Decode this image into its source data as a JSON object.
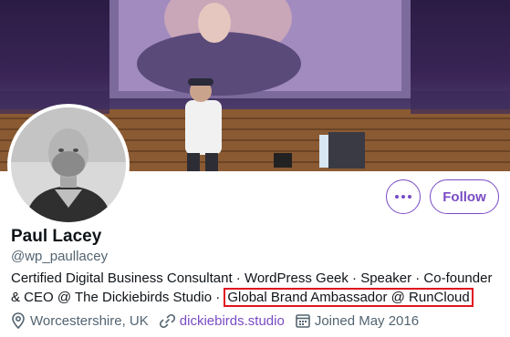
{
  "profile": {
    "display_name": "Paul Lacey",
    "handle": "@wp_paullacey",
    "bio_main": "Certified Digital Business Consultant · WordPress Geek · Speaker · Co-founder & CEO @ The Dickiebirds Studio · ",
    "bio_highlight": "Global Brand Ambassador @ RunCloud",
    "location": "Worcestershire, UK",
    "website": "dickiebirds.studio",
    "joined": "Joined May 2016"
  },
  "actions": {
    "follow_label": "Follow",
    "more_icon": "more-horizontal-icon"
  },
  "icons": {
    "location": "location-pin-icon",
    "website": "link-icon",
    "joined": "calendar-icon"
  },
  "colors": {
    "accent": "#794bc4",
    "highlight_border": "#e0141e",
    "secondary_text": "#536471"
  }
}
